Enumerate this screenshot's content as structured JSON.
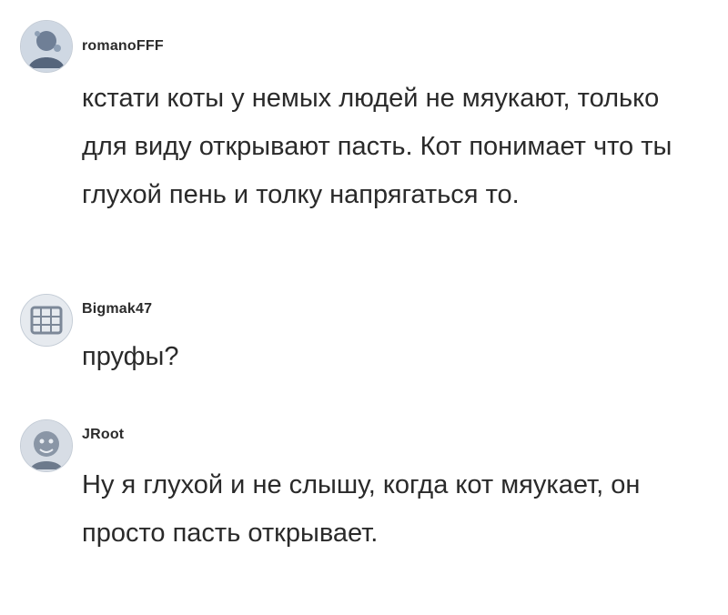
{
  "comments": [
    {
      "username": "romanoFFF",
      "text": "кстати коты у немых людей не мяукают, только для виду открывают пасть. Кот понимает что ты глухой пень и толку напрягаться то."
    },
    {
      "username": "Bigmak47",
      "text": "пруфы?"
    },
    {
      "username": "JRoot",
      "text": "Ну я глухой и не слышу, когда кот мяукает, он просто пасть открывает."
    }
  ]
}
